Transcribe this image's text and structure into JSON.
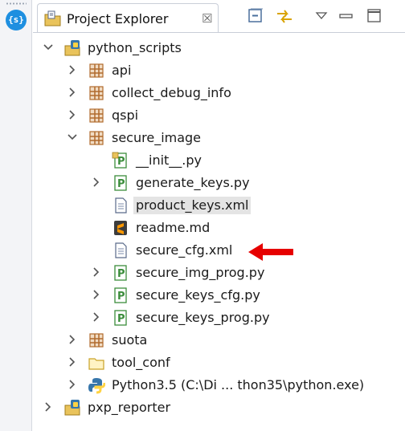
{
  "view": {
    "title": "Project Explorer",
    "close_glyph": "☒"
  },
  "left_strip": {
    "icon_text": "{s}"
  },
  "colors": {
    "package": "#b06a2c",
    "python_file_green": "#3b8d3b",
    "folder": "#e9c35b",
    "arrow": "#e60000",
    "selection": "#e4e4e4",
    "sublime": "#3d3d3d"
  },
  "tree": {
    "items": [
      {
        "label": "python_scripts",
        "icon": "python-project-icon",
        "state": "expanded"
      },
      {
        "label": "api",
        "icon": "package-icon",
        "state": "collapsed"
      },
      {
        "label": "collect_debug_info",
        "icon": "package-icon",
        "state": "collapsed"
      },
      {
        "label": "qspi",
        "icon": "package-icon",
        "state": "collapsed"
      },
      {
        "label": "secure_image",
        "icon": "package-icon",
        "state": "expanded"
      },
      {
        "label": "__init__.py",
        "icon": "python-init-file-icon",
        "state": "leaf"
      },
      {
        "label": "generate_keys.py",
        "icon": "python-file-icon",
        "state": "collapsed"
      },
      {
        "label": "product_keys.xml",
        "icon": "text-file-icon",
        "state": "leaf",
        "selected": true
      },
      {
        "label": "readme.md",
        "icon": "sublime-file-icon",
        "state": "leaf"
      },
      {
        "label": "secure_cfg.xml",
        "icon": "text-file-icon",
        "state": "leaf",
        "highlighted_by": "red-arrow-icon"
      },
      {
        "label": "secure_img_prog.py",
        "icon": "python-file-icon",
        "state": "collapsed"
      },
      {
        "label": "secure_keys_cfg.py",
        "icon": "python-file-icon",
        "state": "collapsed"
      },
      {
        "label": "secure_keys_prog.py",
        "icon": "python-file-icon",
        "state": "collapsed"
      },
      {
        "label": "suota",
        "icon": "package-icon",
        "state": "collapsed"
      },
      {
        "label": "tool_conf",
        "icon": "folder-icon",
        "state": "collapsed"
      },
      {
        "label": "Python3.5  (C:\\Di ... thon35\\python.exe)",
        "icon": "python-interpreter-icon",
        "state": "collapsed"
      },
      {
        "label": "pxp_reporter",
        "icon": "python-project-icon",
        "state": "collapsed"
      }
    ]
  }
}
